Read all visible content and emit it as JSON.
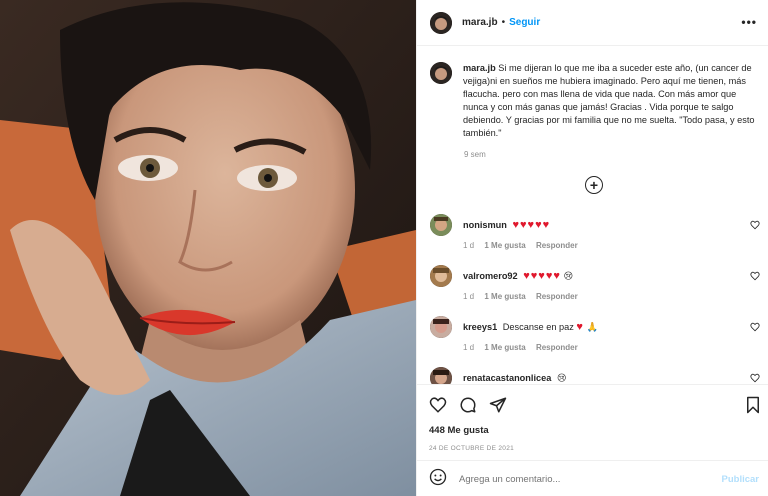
{
  "post": {
    "username": "mara.jb",
    "follow_label": "Seguir",
    "more_label": "•••",
    "caption_user": "mara.jb",
    "caption": "Si me dijeran lo que me iba a suceder este año, (un cancer de vejiga)ni en sueños me hubiera imaginado. Pero aquí me tienen, más flacucha. pero con mas llena de vida que nada. Con más amor que nunca y con más ganas que jamás! Gracias . Vida porque te salgo debiendo. Y gracias por mi familia que no me suelta. \"Todo pasa, y esto también.\"",
    "time": "9 sem",
    "likes": "448 Me gusta",
    "date": "24 DE OCTUBRE DE 2021"
  },
  "comments": [
    {
      "user": "nonismun",
      "text": "♥♥♥♥♥",
      "age": "1 d",
      "likes": "1 Me gusta",
      "reply": "Responder"
    },
    {
      "user": "valromero92",
      "text": "♥♥♥♥♥",
      "emoji": "😢",
      "age": "1 d",
      "likes": "1 Me gusta",
      "reply": "Responder"
    },
    {
      "user": "kreeys1",
      "text": "Descanse en paz",
      "hearts": "♥",
      "emoji": "🙏",
      "age": "1 d",
      "likes": "1 Me gusta",
      "reply": "Responder"
    },
    {
      "user": "renatacastanonlicea",
      "emoji": "😢"
    }
  ],
  "composer": {
    "placeholder": "Agrega un comentario...",
    "publish_label": "Publicar"
  },
  "icons": {
    "emoji": "smiley-icon",
    "like": "heart-icon",
    "comment": "comment-icon",
    "share": "paper-plane-icon",
    "save": "bookmark-icon",
    "load_more": "plus-circle-icon"
  }
}
